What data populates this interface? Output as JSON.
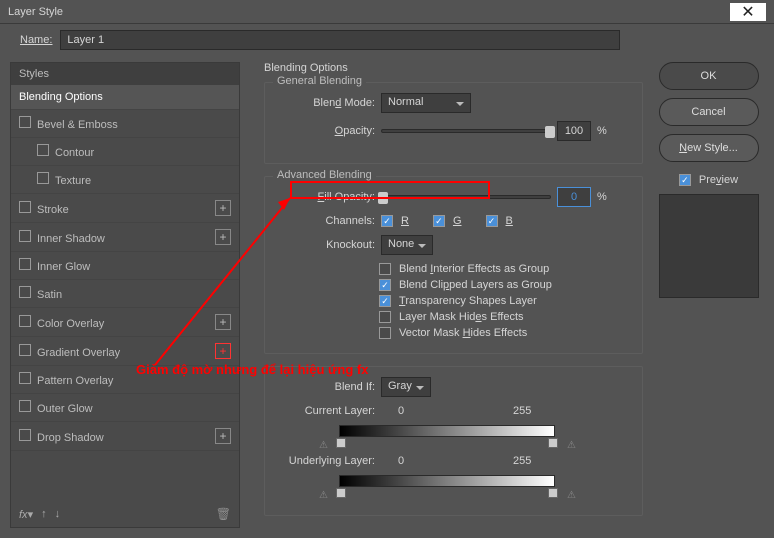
{
  "window": {
    "title": "Layer Style"
  },
  "nameRow": {
    "label": "Name:",
    "value": "Layer 1"
  },
  "sidebar": {
    "header": "Styles",
    "items": [
      {
        "label": "Blending Options",
        "active": true
      },
      {
        "label": "Bevel & Emboss",
        "hasChk": true
      },
      {
        "label": "Contour",
        "sub": true,
        "hasChk": true
      },
      {
        "label": "Texture",
        "sub": true,
        "hasChk": true
      },
      {
        "label": "Stroke",
        "hasChk": true,
        "plus": true
      },
      {
        "label": "Inner Shadow",
        "hasChk": true,
        "plus": true
      },
      {
        "label": "Inner Glow",
        "hasChk": true
      },
      {
        "label": "Satin",
        "hasChk": true
      },
      {
        "label": "Color Overlay",
        "hasChk": true,
        "plus": true
      },
      {
        "label": "Gradient Overlay",
        "hasChk": true,
        "plus": true,
        "plusRed": true
      },
      {
        "label": "Pattern Overlay",
        "hasChk": true
      },
      {
        "label": "Outer Glow",
        "hasChk": true
      },
      {
        "label": "Drop Shadow",
        "hasChk": true,
        "plus": true
      }
    ],
    "footer": {
      "fx": "fx"
    }
  },
  "center": {
    "main_title": "Blending Options",
    "general": {
      "legend": "General Blending",
      "blend_mode_label": "Blend Mode:",
      "blend_mode_value": "Normal",
      "opacity_label": "Opacity:",
      "opacity_value": "100",
      "percent": "%"
    },
    "advanced": {
      "legend": "Advanced Blending",
      "fill_label": "Fill Opacity:",
      "fill_value": "0",
      "percent": "%",
      "channels_label": "Channels:",
      "ch_r": "R",
      "ch_g": "G",
      "ch_b": "B",
      "knockout_label": "Knockout:",
      "knockout_value": "None",
      "opts": [
        {
          "label": "Blend Interior Effects as Group",
          "checked": false
        },
        {
          "label": "Blend Clipped Layers as Group",
          "checked": true
        },
        {
          "label": "Transparency Shapes Layer",
          "checked": true
        },
        {
          "label": "Layer Mask Hides Effects",
          "checked": false
        },
        {
          "label": "Vector Mask Hides Effects",
          "checked": false
        }
      ]
    },
    "blendif": {
      "label": "Blend If:",
      "value": "Gray",
      "current_label": "Current Layer:",
      "current_lo": "0",
      "current_hi": "255",
      "under_label": "Underlying Layer:",
      "under_lo": "0",
      "under_hi": "255"
    }
  },
  "right": {
    "ok": "OK",
    "cancel": "Cancel",
    "newstyle": "New Style...",
    "preview": "Preview"
  },
  "annotation": "Giảm độ mờ nhưng để lại hiệu ứng fx"
}
